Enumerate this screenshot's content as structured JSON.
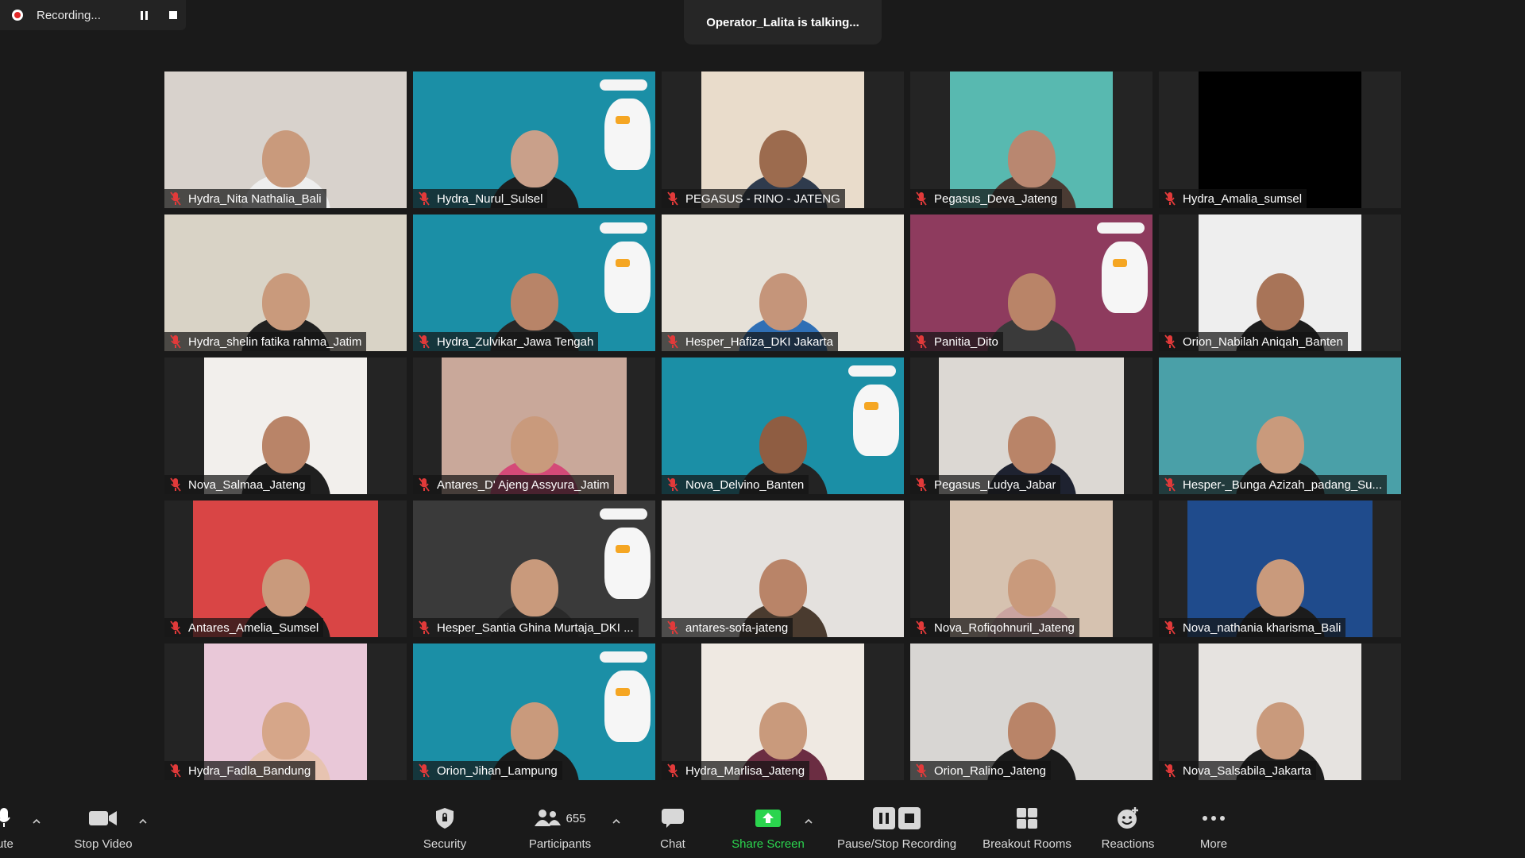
{
  "recording": {
    "label": "Recording..."
  },
  "talking": {
    "text": "Operator_Lalita is talking..."
  },
  "participants": [
    {
      "name": "Hydra_Nita Nathalia_Bali",
      "bg": "#d8d2cc",
      "skin": "#c99a7c",
      "body": "#eeeeee",
      "frame": "full",
      "banner": false
    },
    {
      "name": "Hydra_Nurul_Sulsel",
      "bg": "#1b8fa6",
      "skin": "#c9a08a",
      "body": "#1d1d1d",
      "frame": "full",
      "banner": true
    },
    {
      "name": "PEGASUS - RINO - JATENG",
      "bg": "#e9dccb",
      "skin": "#9c6b4e",
      "body": "#2f3b4d",
      "frame": "narrow",
      "banner": false
    },
    {
      "name": "Pegasus_Deva_Jateng",
      "bg": "#58b9b0",
      "skin": "#b98770",
      "body": "#4a3b33",
      "frame": "narrow",
      "banner": false
    },
    {
      "name": "Hydra_Amalia_sumsel",
      "bg": "#000000",
      "skin": "#000000",
      "body": "#000000",
      "frame": "narrow",
      "banner": false
    },
    {
      "name": "Hydra_shelin fatika rahma_Jatim",
      "bg": "#d9d3c6",
      "skin": "#c99a7c",
      "body": "#202020",
      "frame": "full",
      "banner": false
    },
    {
      "name": "Hydra_Zulvikar_Jawa Tengah",
      "bg": "#1b8fa6",
      "skin": "#b88468",
      "body": "#262626",
      "frame": "full",
      "banner": true
    },
    {
      "name": "Hesper_Hafiza_DKI Jakarta",
      "bg": "#e6e1d8",
      "skin": "#c5957a",
      "body": "#2f6fb5",
      "frame": "full",
      "banner": false
    },
    {
      "name": "Panitia_Dito",
      "bg": "#8e3b5e",
      "skin": "#b98468",
      "body": "#3a3a3a",
      "frame": "full",
      "banner": true
    },
    {
      "name": "Orion_Nabilah Aniqah_Banten",
      "bg": "#eeeeee",
      "skin": "#a87458",
      "body": "#1c1c1c",
      "frame": "narrow",
      "banner": false
    },
    {
      "name": "Nova_Salmaa_Jateng",
      "bg": "#f2efec",
      "skin": "#b98468",
      "body": "#1f1f1f",
      "frame": "narrow",
      "banner": false
    },
    {
      "name": "Antares_D' Ajeng Assyura_Jatim",
      "bg": "#c9a89a",
      "skin": "#c99a7c",
      "body": "#d44a78",
      "frame": "mid",
      "banner": false
    },
    {
      "name": "Nova_Delvino_Banten",
      "bg": "#1b8fa6",
      "skin": "#8f5d42",
      "body": "#232323",
      "frame": "full",
      "banner": true
    },
    {
      "name": "Pegasus_Ludya_Jabar",
      "bg": "#dcd8d3",
      "skin": "#b98468",
      "body": "#1e2230",
      "frame": "mid",
      "banner": false
    },
    {
      "name": "Hesper-_Bunga Azizah_padang_Su...",
      "bg": "#4aa0a8",
      "skin": "#c99a7c",
      "body": "#1f1f1f",
      "frame": "full",
      "banner": false
    },
    {
      "name": "Antares_Amelia_Sumsel",
      "bg": "#d94545",
      "skin": "#c99a7c",
      "body": "#1c1c1c",
      "frame": "mid",
      "banner": false
    },
    {
      "name": "Hesper_Santia Ghina Murtaja_DKI ...",
      "bg": "#3a3a3a",
      "skin": "#c99a7c",
      "body": "#2a2a2a",
      "frame": "full",
      "banner": true
    },
    {
      "name": "antares-sofa-jateng",
      "bg": "#e4e1de",
      "skin": "#b98468",
      "body": "#4a3b2f",
      "frame": "full",
      "banner": false
    },
    {
      "name": "Nova_Rofiqohnuril_Jateng",
      "bg": "#d6c2b0",
      "skin": "#c99a7c",
      "body": "#caa3a0",
      "frame": "narrow",
      "banner": false
    },
    {
      "name": "Nova_nathania kharisma_Bali",
      "bg": "#1f4b8c",
      "skin": "#c99a7c",
      "body": "#1c1c1c",
      "frame": "mid",
      "banner": false
    },
    {
      "name": "Hydra_Fadla_Bandung",
      "bg": "#e9c8d8",
      "skin": "#d6a689",
      "body": "#e7c3b0",
      "frame": "narrow",
      "banner": false
    },
    {
      "name": "Orion_Jihan_Lampung",
      "bg": "#1b8fa6",
      "skin": "#c99a7c",
      "body": "#1b1b1b",
      "frame": "full",
      "banner": true
    },
    {
      "name": "Hydra_Marlisa_Jateng",
      "bg": "#efe9e2",
      "skin": "#c99a7c",
      "body": "#6b2d42",
      "frame": "narrow",
      "banner": false
    },
    {
      "name": "Orion_Ralino_Jateng",
      "bg": "#d8d6d3",
      "skin": "#b98468",
      "body": "#1b1b1b",
      "frame": "full",
      "banner": false
    },
    {
      "name": "Nova_Salsabila_Jakarta",
      "bg": "#e6e3e0",
      "skin": "#c99a7c",
      "body": "#1c1c1c",
      "frame": "narrow",
      "banner": false
    }
  ],
  "toolbar": {
    "mute_label": "ute",
    "stop_video_label": "Stop Video",
    "security_label": "Security",
    "participants_label": "Participants",
    "participants_count": "655",
    "chat_label": "Chat",
    "share_screen_label": "Share Screen",
    "pause_stop_label": "Pause/Stop Recording",
    "breakout_label": "Breakout Rooms",
    "reactions_label": "Reactions",
    "more_label": "More"
  },
  "colors": {
    "background": "#1a1a1a",
    "recording_red": "#e02828",
    "share_green": "#2bd44e",
    "mute_red": "#e23a3a"
  }
}
